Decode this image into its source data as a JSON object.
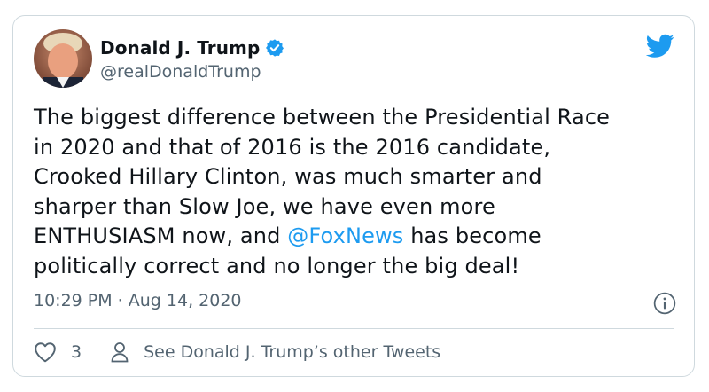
{
  "author": {
    "name": "Donald J. Trump",
    "handle": "@realDonaldTrump",
    "avatar": "profile-photo",
    "verified": true
  },
  "tweet": {
    "text_before": "The biggest difference between the Presidential Race\nin 2020 and that of 2016 is the 2016 candidate,\nCrooked Hillary Clinton, was much smarter and\nsharper than Slow  Joe, we have even more\nENTHUSIASM now, and ",
    "mention": "@FoxNews",
    "text_after": " has become\npolitically correct and no longer the big deal!",
    "timestamp": "10:29 PM · Aug 14, 2020"
  },
  "actions": {
    "like_count": "3",
    "see_other": "See Donald J. Trump’s other Tweets"
  },
  "icons": {
    "brand": "twitter-bird-icon",
    "verified": "verified-badge-icon",
    "info": "info-icon",
    "like": "heart-icon",
    "profile": "person-icon"
  },
  "colors": {
    "accent": "#1d9bf0",
    "text": "#0f1419",
    "muted": "#536471",
    "border": "#cfd9de"
  }
}
